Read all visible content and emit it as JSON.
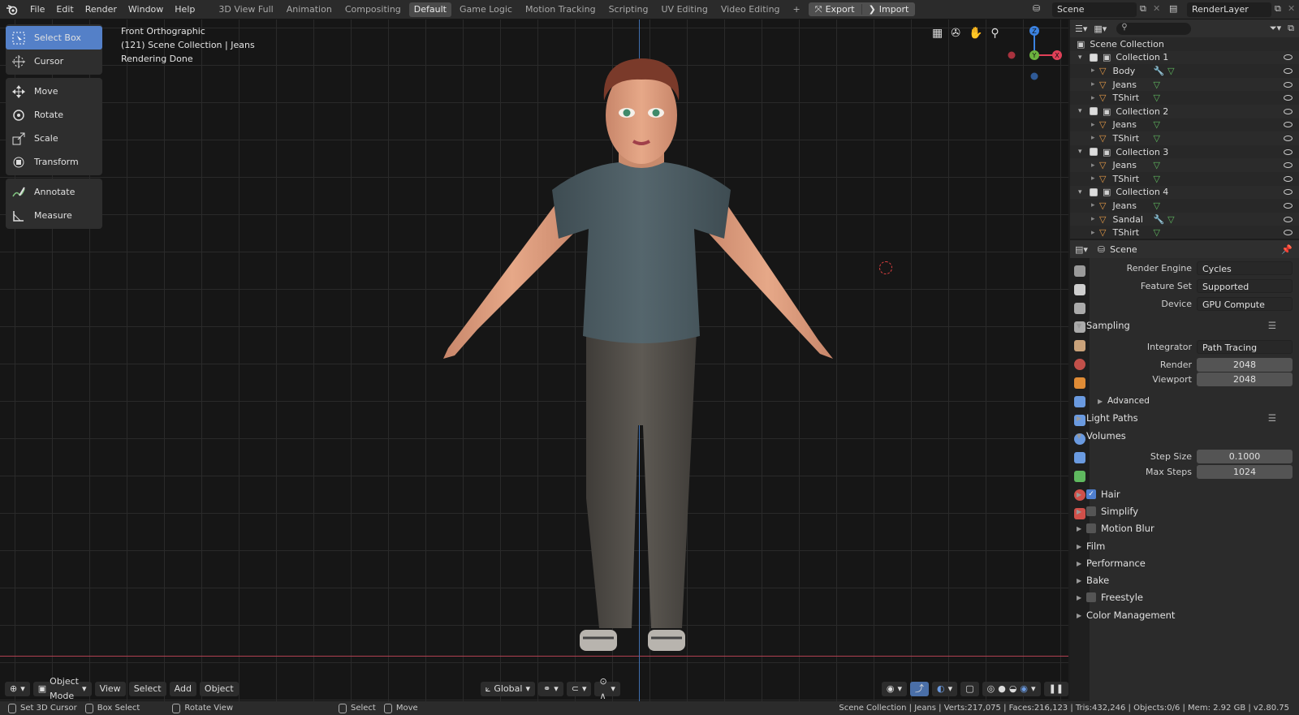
{
  "topbar": {
    "menus": [
      "File",
      "Edit",
      "Render",
      "Window",
      "Help"
    ],
    "workspaces": [
      "3D View Full",
      "Animation",
      "Compositing",
      "Default",
      "Game Logic",
      "Motion Tracking",
      "Scripting",
      "UV Editing",
      "Video Editing"
    ],
    "active_workspace": "Default",
    "add_symbol": "+",
    "export_label": "Export",
    "import_label": "Import",
    "scene_name": "Scene",
    "render_layer": "RenderLayer"
  },
  "toolbox": {
    "group1": [
      "Select Box",
      "Cursor"
    ],
    "group2": [
      "Move",
      "Rotate",
      "Scale",
      "Transform"
    ],
    "group3": [
      "Annotate",
      "Measure"
    ]
  },
  "viewport": {
    "view_name": "Front Orthographic",
    "collection_info": "(121) Scene Collection | Jeans",
    "render_status": "Rendering Done",
    "axes": {
      "z": "Z",
      "y": "Y",
      "x": "X"
    },
    "header": {
      "mode": "Object Mode",
      "menus": [
        "View",
        "Select",
        "Add",
        "Object"
      ],
      "orientation": "Global"
    }
  },
  "outliner": {
    "root": "Scene Collection",
    "collections": [
      {
        "name": "Collection 1",
        "objects": [
          "Body",
          "Jeans",
          "TShirt"
        ]
      },
      {
        "name": "Collection 2",
        "objects": [
          "Jeans",
          "TShirt"
        ]
      },
      {
        "name": "Collection 3",
        "objects": [
          "Jeans",
          "TShirt"
        ]
      },
      {
        "name": "Collection 4",
        "objects": [
          "Jeans",
          "Sandal",
          "TShirt"
        ]
      }
    ]
  },
  "properties": {
    "context": "Scene",
    "render_engine_label": "Render Engine",
    "render_engine": "Cycles",
    "feature_set_label": "Feature Set",
    "feature_set": "Supported",
    "device_label": "Device",
    "device": "GPU Compute",
    "sampling": "Sampling",
    "integrator_label": "Integrator",
    "integrator": "Path Tracing",
    "render_label": "Render",
    "render_samples": "2048",
    "viewport_label": "Viewport",
    "viewport_samples": "2048",
    "advanced": "Advanced",
    "light_paths": "Light Paths",
    "volumes": "Volumes",
    "step_size_label": "Step Size",
    "step_size": "0.1000",
    "max_steps_label": "Max Steps",
    "max_steps": "1024",
    "hair": "Hair",
    "simplify": "Simplify",
    "motion_blur": "Motion Blur",
    "film": "Film",
    "performance": "Performance",
    "bake": "Bake",
    "freestyle": "Freestyle",
    "color_management": "Color Management"
  },
  "statusbar": {
    "set_cursor": "Set 3D Cursor",
    "box_select": "Box Select",
    "rotate_view": "Rotate View",
    "select": "Select",
    "move": "Move",
    "stats": "Scene Collection | Jeans | Verts:217,075 | Faces:216,123 | Tris:432,246 | Objects:0/6 | Mem: 2.92 GB | v2.80.75"
  }
}
